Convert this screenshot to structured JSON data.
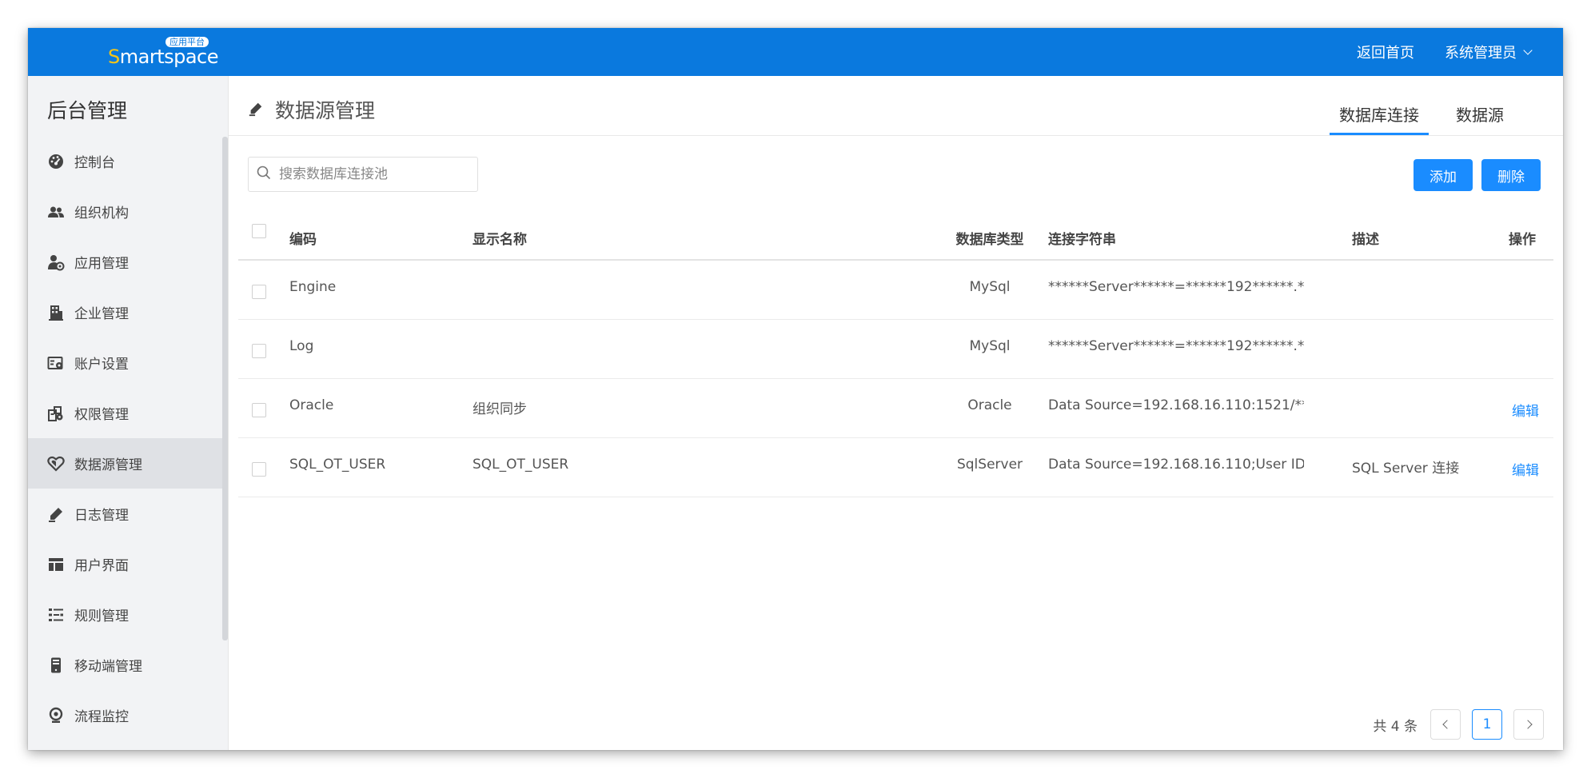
{
  "brand": {
    "s": "S",
    "rest": "martspace",
    "badge": "应用平台"
  },
  "header": {
    "home_link": "返回首页",
    "user_menu": "系统管理员"
  },
  "sidebar": {
    "title": "后台管理",
    "items": [
      {
        "label": "控制台",
        "icon": "dashboard-icon"
      },
      {
        "label": "组织机构",
        "icon": "users-icon"
      },
      {
        "label": "应用管理",
        "icon": "user-gear-icon"
      },
      {
        "label": "企业管理",
        "icon": "building-icon"
      },
      {
        "label": "账户设置",
        "icon": "id-card-gear-icon"
      },
      {
        "label": "权限管理",
        "icon": "permission-icon"
      },
      {
        "label": "数据源管理",
        "icon": "heart-shield-icon",
        "active": true
      },
      {
        "label": "日志管理",
        "icon": "pen-icon"
      },
      {
        "label": "用户界面",
        "icon": "layout-icon"
      },
      {
        "label": "规则管理",
        "icon": "rules-list-icon"
      },
      {
        "label": "移动端管理",
        "icon": "mobile-icon"
      },
      {
        "label": "流程监控",
        "icon": "webcam-icon"
      }
    ]
  },
  "page": {
    "title": "数据源管理",
    "tabs": [
      {
        "label": "数据库连接",
        "active": true
      },
      {
        "label": "数据源",
        "active": false
      }
    ],
    "search_placeholder": "搜索数据库连接池",
    "add_button": "添加",
    "delete_button": "删除"
  },
  "table": {
    "columns": [
      "编码",
      "显示名称",
      "数据库类型",
      "连接字符串",
      "描述",
      "操作"
    ],
    "rows": [
      {
        "code": "Engine",
        "name": "",
        "type": "MySql",
        "conn": "******Server******=******192******.****...",
        "desc": "",
        "op": ""
      },
      {
        "code": "Log",
        "name": "",
        "type": "MySql",
        "conn": "******Server******=******192******.****...",
        "desc": "",
        "op": ""
      },
      {
        "code": "Oracle",
        "name": "组织同步",
        "type": "Oracle",
        "conn": "Data Source=192.168.16.110:1521/****...",
        "desc": "",
        "op": "编辑"
      },
      {
        "code": "SQL_OT_USER",
        "name": "SQL_OT_USER",
        "type": "SqlServer",
        "conn": "Data Source=192.168.16.110;User ID=...",
        "desc": "SQL Server 连接",
        "op": "编辑"
      }
    ]
  },
  "pagination": {
    "total": "共 4 条",
    "current": "1"
  },
  "colors": {
    "primary": "#1a8cff",
    "topbar": "#0a79de",
    "brand_s": "#f5c518"
  }
}
